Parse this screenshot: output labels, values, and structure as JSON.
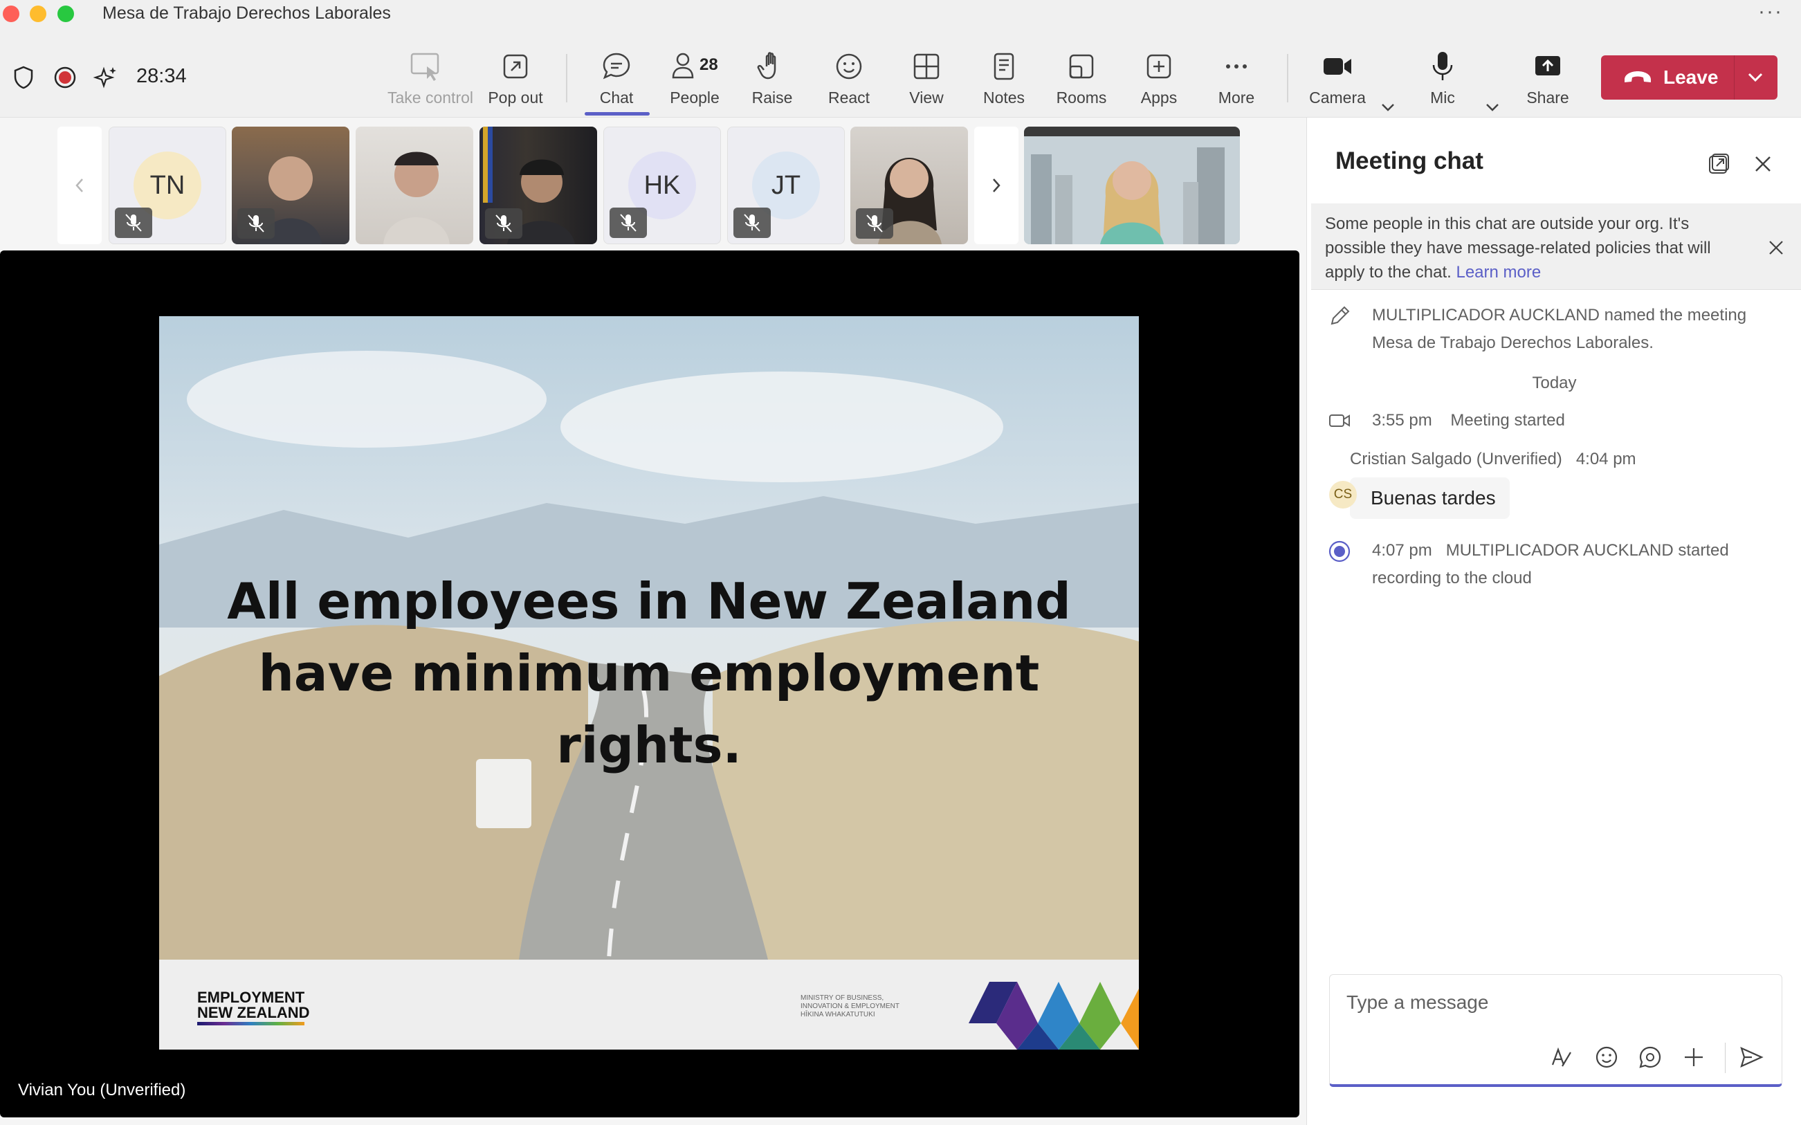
{
  "window": {
    "title": "Mesa de Trabajo Derechos Laborales",
    "more": "···"
  },
  "toolbar": {
    "timer": "28:34",
    "take_control": "Take control",
    "pop_out": "Pop out",
    "chat": "Chat",
    "people": "People",
    "people_count": "28",
    "raise": "Raise",
    "react": "React",
    "view": "View",
    "notes": "Notes",
    "rooms": "Rooms",
    "apps": "Apps",
    "more": "More",
    "camera": "Camera",
    "mic": "Mic",
    "share": "Share",
    "leave": "Leave"
  },
  "participants": [
    {
      "initials": "TN",
      "muted": true,
      "avatar_color": "#f6e9c4"
    },
    {
      "initials": "",
      "muted": true,
      "video": true
    },
    {
      "initials": "",
      "muted": false,
      "video": true
    },
    {
      "initials": "",
      "muted": true,
      "video": true
    },
    {
      "initials": "HK",
      "muted": true,
      "avatar_color": "#e1e1f4"
    },
    {
      "initials": "JT",
      "muted": true,
      "avatar_color": "#dce6f2"
    },
    {
      "initials": "",
      "muted": true,
      "video": true
    }
  ],
  "stage": {
    "slide_line1": "All employees in New Zealand",
    "slide_line2": "have minimum employment rights.",
    "logo_line1": "EMPLOYMENT",
    "logo_line2": "NEW ZEALAND",
    "mbie_line1": "MINISTRY OF BUSINESS,",
    "mbie_line2": "INNOVATION & EMPLOYMENT",
    "mbie_line3": "HĪKINA WHAKATUTUKI",
    "speaker": "Vivian You (Unverified)"
  },
  "chat": {
    "title": "Meeting chat",
    "banner": "Some people in this chat are outside your org. It's possible they have message-related policies that will apply to the chat.",
    "banner_link": "Learn more",
    "rename_line1": "MULTIPLICADOR AUCKLAND named the meeting",
    "rename_line2": "Mesa de Trabajo Derechos Laborales.",
    "today": "Today",
    "started_time": "3:55 pm",
    "started_text": "Meeting started",
    "msg_author": "Cristian Salgado (Unverified)",
    "msg_time": "4:04 pm",
    "msg_initials": "CS",
    "msg_text": "Buenas tardes",
    "rec_time": "4:07 pm",
    "rec_line1": "MULTIPLICADOR AUCKLAND started",
    "rec_line2": "recording to the cloud",
    "composer_placeholder": "Type a message"
  },
  "colors": {
    "accent": "#5b5fc7",
    "leave": "#c4314b",
    "record": "#d13438"
  }
}
